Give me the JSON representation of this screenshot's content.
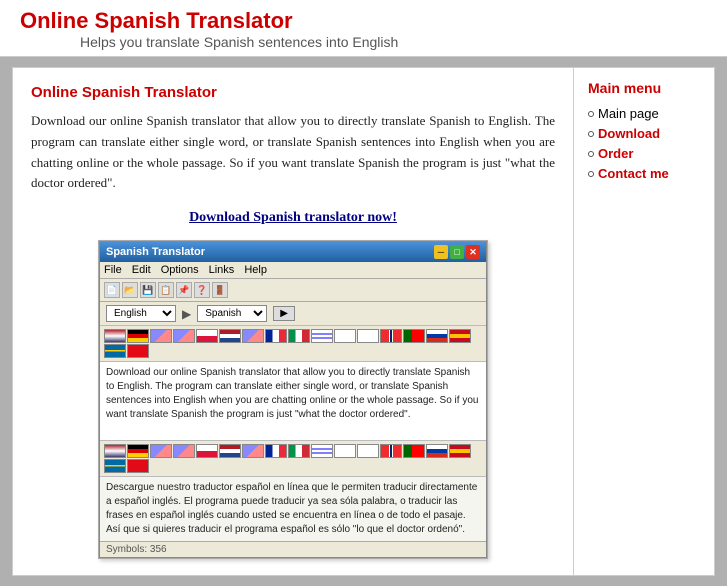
{
  "header": {
    "title": "Online Spanish Translator",
    "subtitle": "Helps you translate Spanish sentences into English"
  },
  "content": {
    "title": "Online Spanish Translator",
    "body": "Download our online Spanish translator that allow you to directly translate Spanish to English. The program can translate either single word, or translate Spanish sentences into English when you are chatting online or the whole passage. So if you want translate Spanish the program is just \"what the doctor ordered\".",
    "download_heading": "Download Spanish translator now!"
  },
  "app_window": {
    "title": "Spanish Translator",
    "menu_items": [
      "File",
      "Edit",
      "Options",
      "Links",
      "Help"
    ],
    "lang_from": "English",
    "lang_to": "Spanish",
    "source_text": "Download our online Spanish translator that allow you to directly translate Spanish to English. The program can translate either single word, or translate Spanish sentences into English when you are chatting online or the whole passage. So if you want translate Spanish the program is just \"what the doctor ordered\".",
    "translated_text": "Descargue nuestro traductor español en línea que le permiten traducir directamente a español inglés. El programa puede traducir ya sea sóla palabra, o traducir las frases en español inglés cuando usted se encuentra en línea o de todo el pasaje. Así que si quieres traducir el programa español es sólo \"lo que el doctor ordenó\".",
    "statusbar": "Symbols: 356"
  },
  "sidebar": {
    "title": "Main menu",
    "items": [
      {
        "label": "Main page",
        "active": false,
        "href": "#"
      },
      {
        "label": "Download",
        "active": true,
        "href": "#"
      },
      {
        "label": "Order",
        "active": true,
        "href": "#"
      },
      {
        "label": "Contact me",
        "active": true,
        "href": "#"
      }
    ]
  },
  "flags": [
    "us",
    "de",
    "cz",
    "sk",
    "pl",
    "nl",
    "fi",
    "fr",
    "it",
    "il",
    "jp",
    "kr",
    "no",
    "pt",
    "ru",
    "es",
    "se",
    "tr"
  ]
}
